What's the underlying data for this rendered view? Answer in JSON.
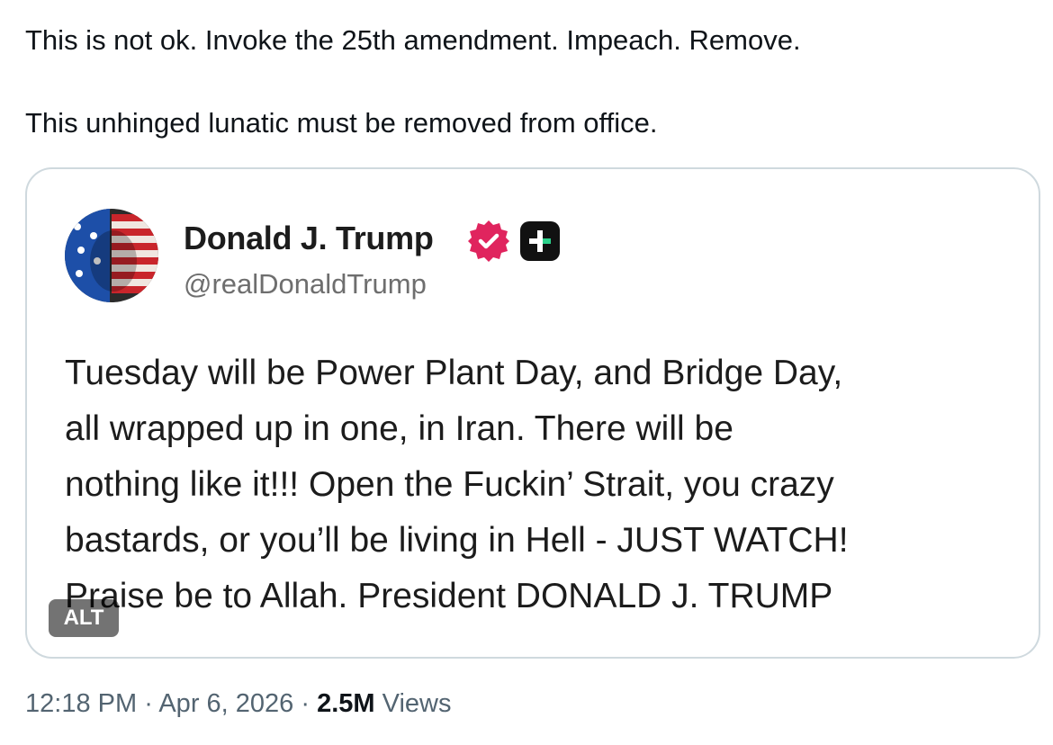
{
  "tweet": {
    "text_lines": [
      "This is not ok. Invoke the 25th amendment. Impeach. Remove.",
      "This unhinged lunatic must be removed from office."
    ],
    "timestamp": "12:18 PM",
    "separator": "·",
    "date": "Apr 6, 2026",
    "views_count": "2.5M",
    "views_label": "Views"
  },
  "media": {
    "alt_label": "ALT",
    "author": {
      "name": "Donald J. Trump",
      "handle": "@realDonaldTrump",
      "badge_icon": "verified-icon",
      "badge_color": "#e0245e",
      "plus_icon": "plus-icon"
    },
    "post_lines": [
      "Tuesday will be Power Plant Day, and Bridge Day,",
      "all wrapped up in one, in Iran. There will be",
      "nothing like it!!! Open the Fuckin’ Strait, you crazy",
      "bastards, or you’ll be living in Hell - JUST WATCH!",
      "Praise be to Allah. President DONALD J. TRUMP"
    ]
  },
  "colors": {
    "text": "#0f1419",
    "secondary": "#536471",
    "border": "#cfd9de"
  }
}
